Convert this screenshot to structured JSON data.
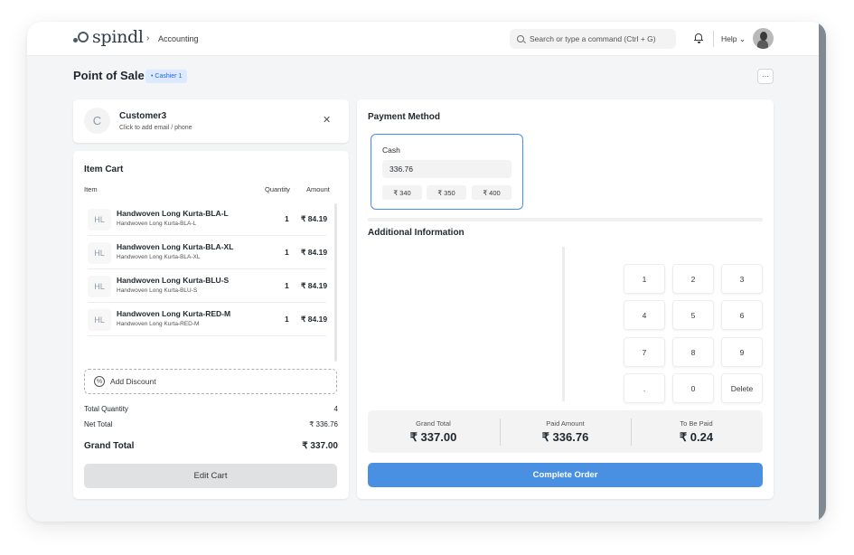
{
  "navbar": {
    "logo_text": "spindl",
    "breadcrumb_separator": "›",
    "breadcrumb": "Accounting",
    "search_placeholder": "Search or type a command (Ctrl + G)",
    "help_label": "Help ⌄"
  },
  "page": {
    "title": "Point of Sale",
    "cashier_badge": "• Cashier 1",
    "more_label": "···"
  },
  "customer": {
    "initial": "C",
    "name": "Customer3",
    "subtitle": "Click to add email / phone",
    "close_label": "✕"
  },
  "cart": {
    "title": "Item Cart",
    "headers": {
      "item": "Item",
      "quantity": "Quantity",
      "amount": "Amount"
    },
    "items": [
      {
        "abbr": "HL",
        "name": "Handwoven Long Kurta-BLA-L",
        "sub": "Handwoven Long Kurta-BLA-L",
        "qty": "1",
        "amount": "₹ 84.19"
      },
      {
        "abbr": "HL",
        "name": "Handwoven Long Kurta-BLA-XL",
        "sub": "Handwoven Long Kurta-BLA-XL",
        "qty": "1",
        "amount": "₹ 84.19"
      },
      {
        "abbr": "HL",
        "name": "Handwoven Long Kurta-BLU-S",
        "sub": "Handwoven Long Kurta-BLU-S",
        "qty": "1",
        "amount": "₹ 84.19"
      },
      {
        "abbr": "HL",
        "name": "Handwoven Long Kurta-RED-M",
        "sub": "Handwoven Long Kurta-RED-M",
        "qty": "1",
        "amount": "₹ 84.19"
      }
    ],
    "discount_icon": "%",
    "discount_label": "Add Discount",
    "total_quantity_label": "Total Quantity",
    "total_quantity": "4",
    "net_total_label": "Net Total",
    "net_total": "₹ 336.76",
    "grand_total_label": "Grand Total",
    "grand_total": "₹ 337.00",
    "edit_cart_label": "Edit Cart"
  },
  "payment": {
    "title": "Payment Method",
    "mode": {
      "label": "Cash",
      "value": "336.76",
      "quick_amounts": [
        "₹ 340",
        "₹ 350",
        "₹ 400"
      ]
    },
    "additional_info_title": "Additional Information",
    "numpad": [
      "1",
      "2",
      "3",
      "4",
      "5",
      "6",
      "7",
      "8",
      "9",
      ".",
      "0",
      "Delete"
    ],
    "totals": [
      {
        "label": "Grand Total",
        "value": "₹ 337.00"
      },
      {
        "label": "Paid Amount",
        "value": "₹ 336.76"
      },
      {
        "label": "To Be Paid",
        "value": "₹ 0.24"
      }
    ],
    "complete_label": "Complete Order"
  },
  "colors": {
    "accent": "#4a90e2",
    "badge_bg": "#dbeafe",
    "badge_text": "#2563eb"
  }
}
